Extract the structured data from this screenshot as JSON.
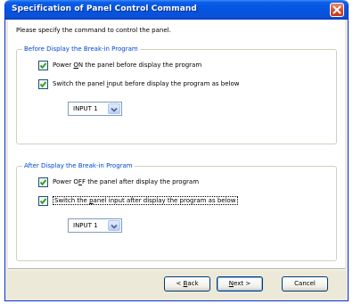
{
  "window": {
    "title": "Specification of Panel Control Command"
  },
  "prompt": "Please specify the command to control the panel.",
  "before_group": {
    "legend": "Before Display the Break-in Program",
    "power_on": {
      "pre": "Power ",
      "key": "O",
      "post": "N the panel before display the program",
      "checked": true
    },
    "switch_input": {
      "pre": "Switch the panel ",
      "key": "i",
      "post": "nput before display the program as below",
      "checked": true
    },
    "input_select": {
      "value": "INPUT 1"
    }
  },
  "after_group": {
    "legend": "After Display the Break-in Program",
    "power_off": {
      "pre": "Power O",
      "key": "F",
      "post": "F the panel after display the program",
      "checked": true
    },
    "switch_input": {
      "pre": "Switch the ",
      "key": "p",
      "post": "anel input after display the program as below",
      "checked": true
    },
    "input_select": {
      "value": "INPUT 1"
    }
  },
  "buttons": {
    "back": {
      "pre": "< ",
      "key": "B",
      "post": "ack"
    },
    "next": {
      "pre": "",
      "key": "N",
      "post": "ext >"
    },
    "cancel": {
      "label": "Cancel"
    }
  },
  "colors": {
    "title_bar": "#0454e0",
    "group_legend": "#0046d5",
    "dialog_face": "#ece9d8",
    "check_mark": "#21a121"
  }
}
